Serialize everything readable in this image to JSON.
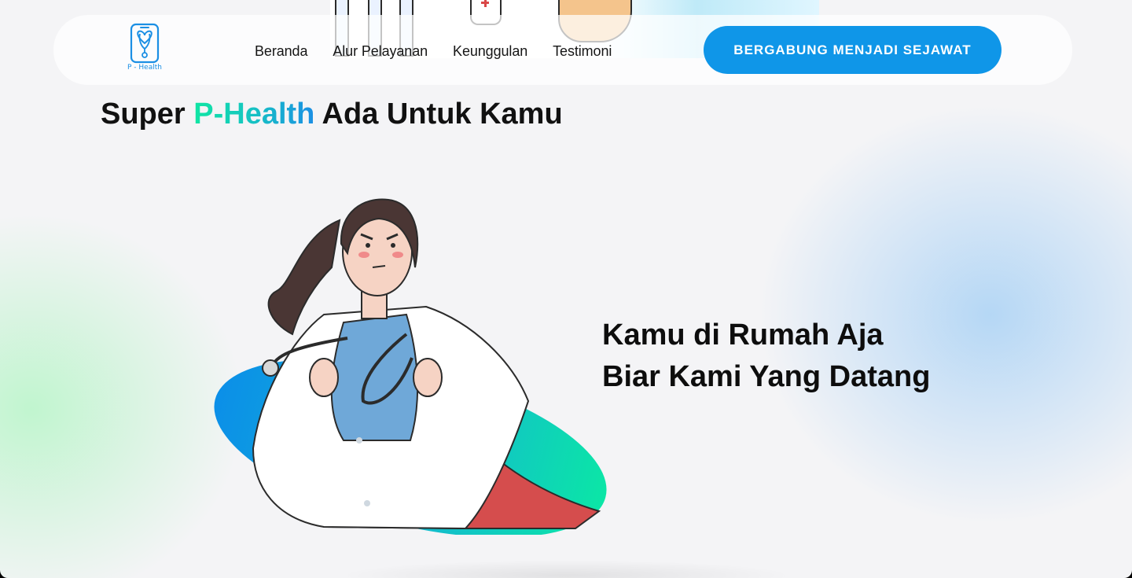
{
  "navbar": {
    "logo_text": "P - Health",
    "links": [
      {
        "label": "Beranda"
      },
      {
        "label": "Alur Pelayanan"
      },
      {
        "label": "Keunggulan"
      },
      {
        "label": "Testimoni"
      }
    ],
    "cta_label": "BERGABUNG MENJADI SEJAWAT"
  },
  "hero": {
    "title_prefix": "Super ",
    "title_brand": "P-Health",
    "title_suffix": " Ada Untuk Kamu",
    "tagline_line1": "Kamu di Rumah Aja",
    "tagline_line2": "Biar Kami Yang Datang"
  },
  "colors": {
    "primary_button": "#0f96e8",
    "brand_gradient_start": "#10e6a3",
    "brand_gradient_end": "#1b8fe4",
    "logo_blue": "#1b8fe4"
  },
  "icons": {
    "logo": "phone-heart-stethoscope-icon"
  }
}
